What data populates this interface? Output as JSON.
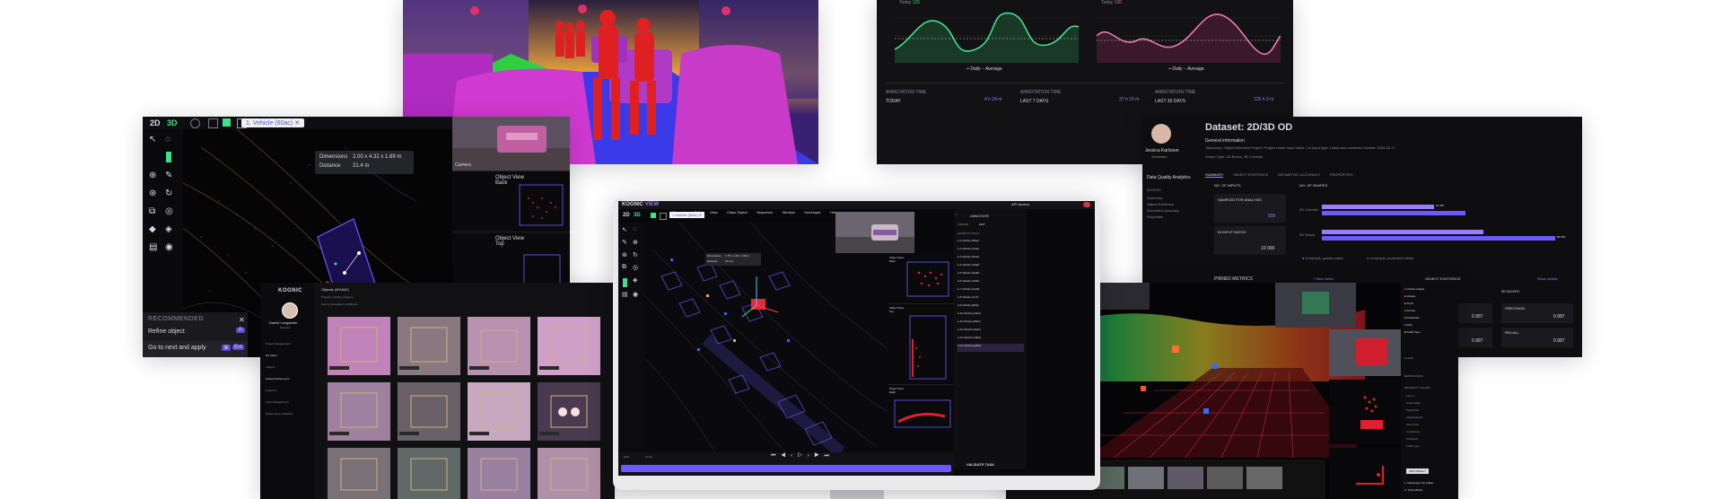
{
  "segmentation": {
    "label": ""
  },
  "analytics": {
    "chart1_title": "Today",
    "chart1_title2": "125",
    "chart2_title": "Today",
    "chart2_title2": "130",
    "legend_daily": "Daily",
    "legend_average": "Average",
    "stats": [
      {
        "label": "ANNOTATION TIME",
        "period": "TODAY",
        "value": "4 h 24 m"
      },
      {
        "label": "ANNOTATION TIME",
        "period": "LAST 7 DAYS",
        "value": "37 h 23 m"
      },
      {
        "label": "ANNOTATION TIME",
        "period": "LAST 30 DAYS",
        "value": "126 h 3 m"
      }
    ]
  },
  "lidar_tool": {
    "mode_2d": "2D",
    "mode_3d": "3D",
    "selected_tab": "1. Vehicle (60ac)",
    "dimensions_label": "Dimensions",
    "dimensions_value": "2.00 x 4.32 x 1.69 m",
    "distance_label": "Distance",
    "distance_value": "21.4 m",
    "camera_label": "Camera",
    "object_view_back": "Object View\nBack",
    "object_view_top": "Object View\nTop",
    "recommended_title": "RECOMMENDED",
    "recommended_item": "Refine object",
    "recommended_key": "R",
    "next_label": "Go to next and apply",
    "next_key1": "⌘",
    "next_key2": "Ent"
  },
  "dataset": {
    "title": "Dataset:",
    "name": "2D/3D OD",
    "user_name": "Jessica Karlsson",
    "user_role": "Annotator",
    "general_info": "General information",
    "info_line": "Taxonomy: Object Detection   Project: Project name   Input batch: 1st   Input type: Lidars and cameras   Created: 2022-02-17",
    "shape_line": "Shape Type:   2D Boxes, 3D Cuboids",
    "tabs": [
      "SUMMARY",
      "OBJECT EXISTENCE",
      "GEOMETRIC ACCURACY",
      "PROPERTIES"
    ],
    "sidebar_title": "Data Quality Analytics",
    "sidebar_items": [
      "00:00:00",
      "Summary",
      "Object Existence",
      "Geometric Accuracy",
      "Properties"
    ],
    "no_inputs": "NO. OF INPUTS",
    "no_shapes": "NO. OF SHAPES",
    "sampled_label": "SAMPLED FOR ANALYSIS",
    "sampled_value": "500",
    "in_input_batch": "IN INPUT BATCH",
    "batch_value": "10 000",
    "bar_labels": [
      "2D Cuboids",
      "2D Boxes"
    ],
    "bar_values": [
      "20 487",
      "88 566"
    ],
    "legend_golden": "In sample, golden tasks",
    "legend_production": "In sample, production tasks",
    "pinned_metrics": "PINNED METRICS",
    "new_metric": "+ New metric",
    "object_existence": "OBJECT EXISTENCE",
    "show_details": "Show details",
    "metric_2d": "2D BOXES",
    "precision": "PRECISION",
    "recall": "RECALL",
    "precision_value": "0.987",
    "recall_value": "0.987",
    "left_values": [
      "0.987",
      "0.987"
    ]
  },
  "gallery": {
    "logo": "KOGNIC",
    "header": "Objects (491842)",
    "filter1": "Property:  vehicle_category",
    "filter2": "Sort by:  Annotation confidence",
    "user_name": "Daniel Lengström",
    "user_role": "Engineer",
    "nav": [
      "Project Management",
      "My Tasks",
      "Insights",
      "Dataset Refinement",
      "Analytics",
      "Team Management",
      "Performance Analytics"
    ],
    "tag": "unspecified"
  },
  "main_app": {
    "logo": "KOGNIC",
    "logo_suffix": "VIEW",
    "menu": [
      "General",
      "Edit",
      "View",
      "Class Object",
      "Sequence",
      "Window",
      "Developer",
      "Help"
    ],
    "status": "API Access",
    "mode_2d": "2D",
    "mode_3d": "3D",
    "tab": "1 Vehicle (60ac)",
    "dimensions": "1.75 x 4.40 x 1.50 m",
    "distance": "21.4 m",
    "annotate_title": "ANNOTATE",
    "create_label": "CREATE",
    "edit_label": "EDIT",
    "objects_header": "OBJECTS (14/14)",
    "object_list": [
      "1 Vehicle (60ac)",
      "2 Vehicle (21dc)",
      "3 Vehicle (4b01)",
      "4 Vehicle (1d40)",
      "5 Vehicle (4e0b)",
      "6 Vehicle (7d2b)",
      "7 Vehicle (b1e8)",
      "8 Vehicle (1c7f)",
      "9 Vehicle (f00a)",
      "10 Vehicle (2dc4)",
      "11 Vehicle (9bd1)",
      "12 Vehicle (0a11)",
      "13 Vehicle (c8e9)",
      "14 Vehicle (a2b0)"
    ],
    "object_view_back": "Object View\nBack",
    "object_view_top": "Object View\nTop",
    "object_view_right": "Object View\nRight",
    "timeline_frame": "0/40",
    "timeline_fps": "10 fps",
    "validate": "VALIDATE TASK",
    "camera_label": "Camera"
  },
  "pc3d": {
    "classes": [
      "Vehicle (4aed)",
      "Vehicle",
      "Truck",
      "Animal",
      "Pedestrian",
      "Pole",
      "Traffic Sign"
    ],
    "sections": [
      "SENSOR DATA",
      "PROPERTY VALUES",
      "CLASS"
    ],
    "properties": [
      "Lane 1",
      "Unidentified",
      "Pedestrian",
      "Vehicle(4aed)",
      "Size/Truck",
      "Confidence",
      "Occluded",
      "Traffic type"
    ],
    "button": "ADD OBJECT",
    "bottom_items": [
      "1. Passenger Car (2f0a)",
      "2. Truck (8b21)"
    ]
  }
}
